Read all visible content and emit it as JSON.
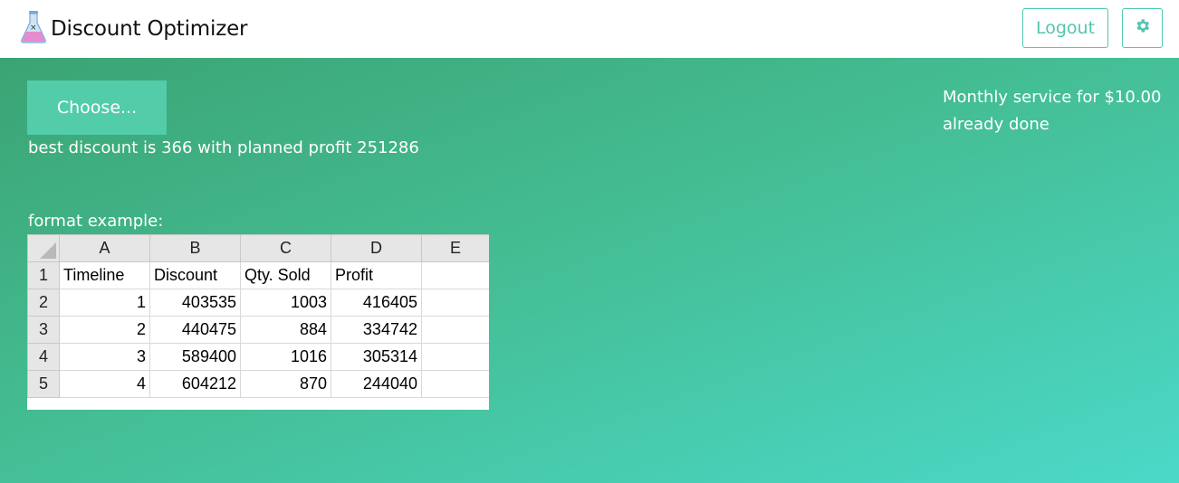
{
  "header": {
    "title": "Discount Optimizer",
    "logo_icon": "flask-icon",
    "logout_label": "Logout",
    "settings_icon": "gear-icon"
  },
  "main": {
    "choose_label": "Choose...",
    "result_text": "best discount is 366 with planned profit 251286",
    "format_label": "format example:",
    "service_line1": "Monthly service for $10.00",
    "service_line2": "already done"
  },
  "example_sheet": {
    "column_letters": [
      "A",
      "B",
      "C",
      "D",
      "E"
    ],
    "row_numbers": [
      "1",
      "2",
      "3",
      "4",
      "5"
    ],
    "headers": [
      "Timeline",
      "Discount",
      "Qty. Sold",
      "Profit"
    ],
    "rows": [
      [
        "1",
        "403535",
        "1003",
        "416405"
      ],
      [
        "2",
        "440475",
        "884",
        "334742"
      ],
      [
        "3",
        "589400",
        "1016",
        "305314"
      ],
      [
        "4",
        "604212",
        "870",
        "244040"
      ]
    ]
  },
  "colors": {
    "accent": "#52c6ae",
    "button_fill": "#52cca9",
    "gradient_start": "#3ba474",
    "gradient_end": "#4bd9c8"
  }
}
